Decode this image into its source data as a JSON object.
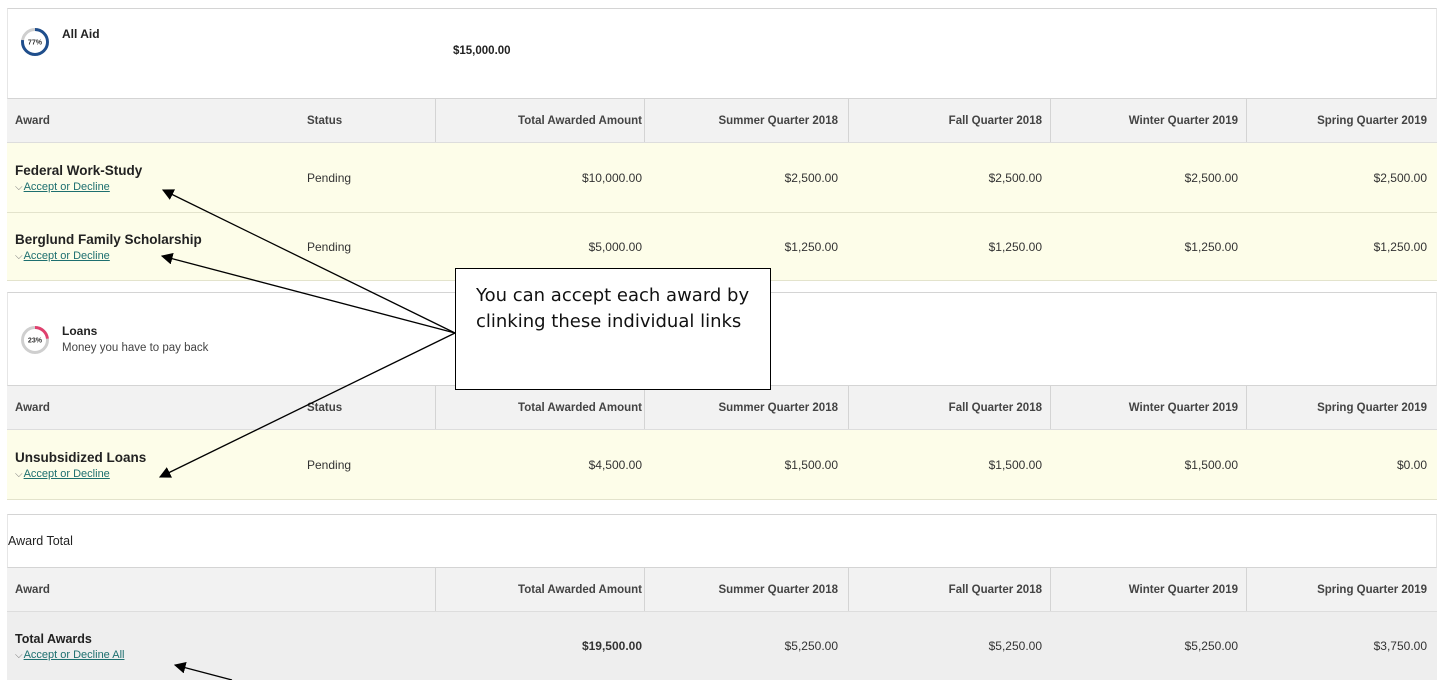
{
  "all_aid": {
    "percent": "77%",
    "percent_value": 77,
    "title": "All Aid",
    "amount": "$15,000.00"
  },
  "columns": {
    "award": "Award",
    "status": "Status",
    "total": "Total Awarded Amount",
    "q1": "Summer Quarter 2018",
    "q2": "Fall Quarter 2018",
    "q3": "Winter Quarter 2019",
    "q4": "Spring Quarter 2019"
  },
  "grants": [
    {
      "name": "Federal Work-Study",
      "link": "Accept or Decline",
      "status": "Pending",
      "total": "$10,000.00",
      "q1": "$2,500.00",
      "q2": "$2,500.00",
      "q3": "$2,500.00",
      "q4": "$2,500.00"
    },
    {
      "name": "Berglund Family Scholarship",
      "link": "Accept or Decline",
      "status": "Pending",
      "total": "$5,000.00",
      "q1": "$1,250.00",
      "q2": "$1,250.00",
      "q3": "$1,250.00",
      "q4": "$1,250.00"
    }
  ],
  "loans": {
    "percent": "23%",
    "percent_value": 23,
    "title": "Loans",
    "subtitle": "Money you have to pay back",
    "rows": [
      {
        "name": "Unsubsidized Loans",
        "link": "Accept or Decline",
        "status": "Pending",
        "total": "$4,500.00",
        "q1": "$1,500.00",
        "q2": "$1,500.00",
        "q3": "$1,500.00",
        "q4": "$0.00"
      }
    ]
  },
  "award_total": {
    "title": "Award Total",
    "row": {
      "name": "Total Awards",
      "link": "Accept or Decline All",
      "total": "$19,500.00",
      "q1": "$5,250.00",
      "q2": "$5,250.00",
      "q3": "$5,250.00",
      "q4": "$3,750.00"
    }
  },
  "callout": {
    "text": "You can accept each award by clinking these individual links"
  },
  "colors": {
    "ring_blue": "#1f4e8c",
    "ring_pink": "#e0406e",
    "ring_track": "#cfcfcf",
    "link": "#1d6f6f",
    "pending_row": "#fdfde9"
  }
}
